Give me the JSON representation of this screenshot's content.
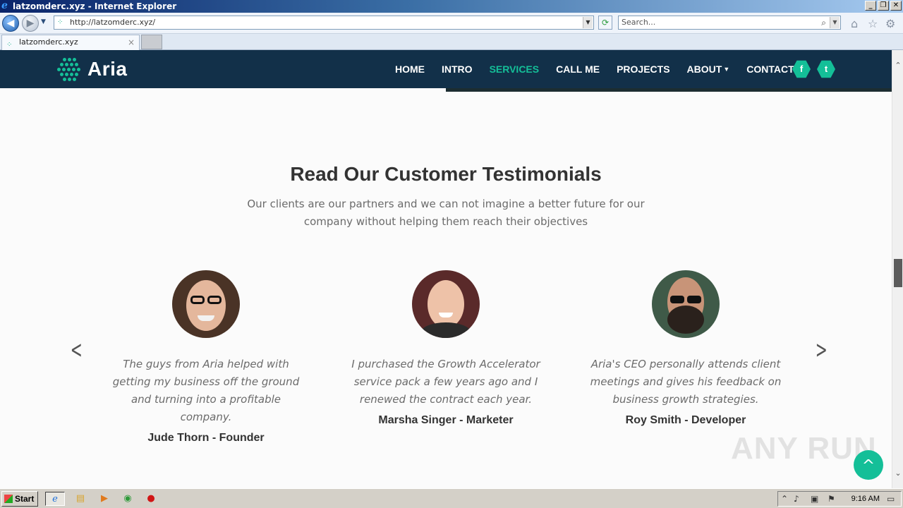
{
  "window": {
    "title": "latzomderc.xyz - Internet Explorer",
    "buttons": {
      "minimize": "_",
      "restore": "❐",
      "close": "✕"
    }
  },
  "browser": {
    "address": "http://latzomderc.xyz/",
    "search_placeholder": "Search...",
    "tab_title": "latzomderc.xyz"
  },
  "site": {
    "logo_text": "Aria",
    "nav": [
      {
        "label": "HOME",
        "active": false
      },
      {
        "label": "INTRO",
        "active": false
      },
      {
        "label": "SERVICES",
        "active": true
      },
      {
        "label": "CALL ME",
        "active": false
      },
      {
        "label": "PROJECTS",
        "active": false
      },
      {
        "label": "ABOUT",
        "active": false,
        "dropdown": true
      },
      {
        "label": "CONTACT",
        "active": false
      }
    ],
    "social": {
      "facebook": "f",
      "twitter": "t"
    },
    "accent_color": "#14bf98",
    "nav_bg_color": "#123049"
  },
  "testimonials": {
    "title": "Read Our Customer Testimonials",
    "subtitle": "Our clients are our partners and we can not imagine a better future for our company without helping them reach their objectives",
    "items": [
      {
        "quote": "The guys from Aria helped with getting my business off the ground and turning into a profitable company.",
        "author": "Jude Thorn - Founder"
      },
      {
        "quote": "I purchased the Growth Accelerator service pack a few years ago and I renewed the contract each year.",
        "author": "Marsha Singer - Marketer"
      },
      {
        "quote": "Aria's CEO personally attends client meetings and gives his feedback on business growth strategies.",
        "author": "Roy Smith - Developer"
      }
    ]
  },
  "watermark": "ANY RUN",
  "taskbar": {
    "start_label": "Start",
    "clock": "9:16 AM"
  }
}
